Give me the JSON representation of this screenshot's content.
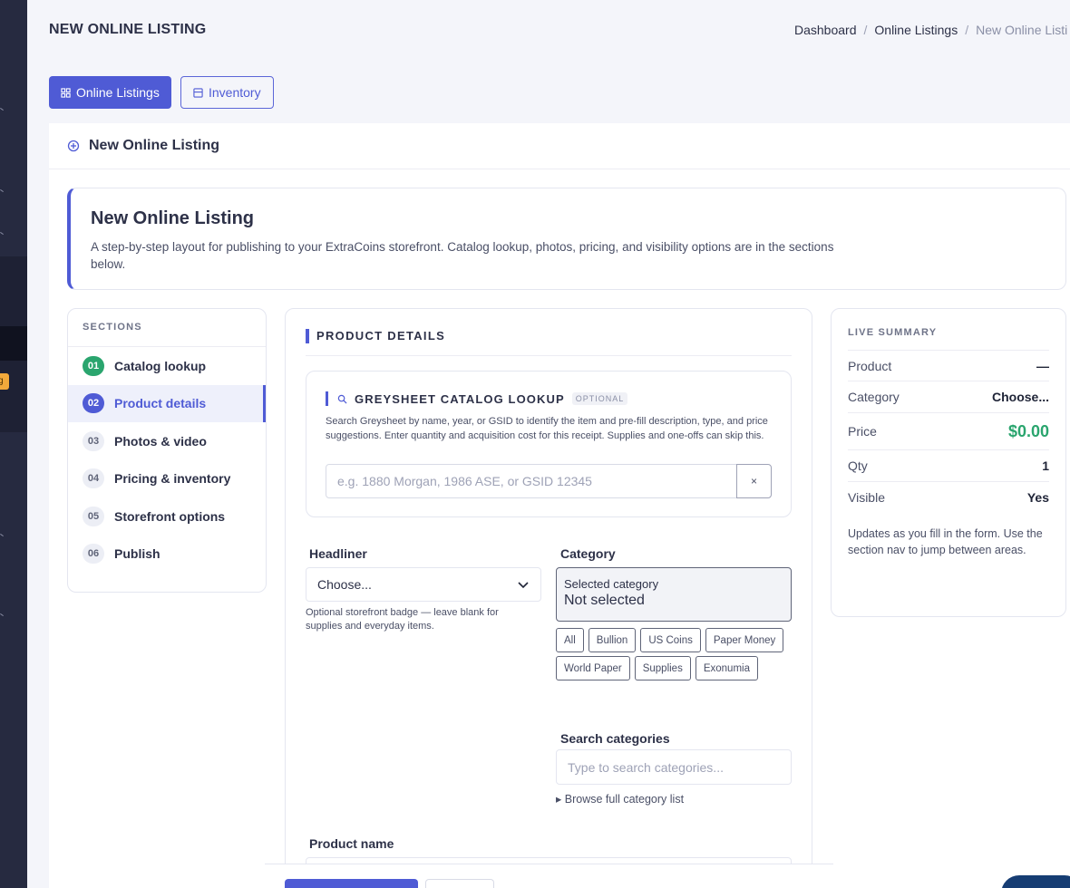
{
  "page": {
    "title": "NEW ONLINE LISTING"
  },
  "breadcrumb": {
    "items": [
      "Dashboard",
      "Online Listings"
    ],
    "current": "New Online Listi"
  },
  "tabs": {
    "online_listings": "Online Listings",
    "inventory": "Inventory"
  },
  "card": {
    "header": "New Online Listing"
  },
  "hero": {
    "title": "New Online Listing",
    "description": "A step-by-step layout for publishing to your ExtraCoins storefront. Catalog lookup, photos, pricing, and visibility options are in the sections below."
  },
  "sections": {
    "heading": "SECTIONS",
    "items": [
      {
        "num": "01",
        "label": "Catalog lookup",
        "state": "done"
      },
      {
        "num": "02",
        "label": "Product details",
        "state": "active"
      },
      {
        "num": "03",
        "label": "Photos & video",
        "state": "pending"
      },
      {
        "num": "04",
        "label": "Pricing & inventory",
        "state": "pending"
      },
      {
        "num": "05",
        "label": "Storefront options",
        "state": "pending"
      },
      {
        "num": "06",
        "label": "Publish",
        "state": "pending"
      }
    ]
  },
  "details": {
    "title": "PRODUCT DETAILS",
    "lookup": {
      "title": "GREYSHEET CATALOG LOOKUP",
      "tag": "OPTIONAL",
      "description": "Search Greysheet by name, year, or GSID to identify the item and pre-fill description, type, and price suggestions. Enter quantity and acquisition cost for this receipt. Supplies and one-offs can skip this.",
      "placeholder": "e.g. 1880 Morgan, 1986 ASE, or GSID 12345",
      "clear": "×"
    },
    "headliner": {
      "label": "Headliner",
      "value": "Choose...",
      "hint": "Optional storefront badge — leave blank for supplies and everyday items."
    },
    "category": {
      "label": "Category",
      "selected_label": "Selected category",
      "selected_value": "Not selected",
      "chips": [
        "All",
        "Bullion",
        "US Coins",
        "Paper Money",
        "World Paper",
        "Supplies",
        "Exonumia"
      ],
      "search_label": "Search categories",
      "search_placeholder": "Type to search categories...",
      "browse": "▸ Browse full category list"
    },
    "product_name": {
      "label": "Product name"
    }
  },
  "summary": {
    "heading": "LIVE SUMMARY",
    "rows": [
      {
        "label": "Product",
        "value": "—"
      },
      {
        "label": "Category",
        "value": "Choose..."
      },
      {
        "label": "Price",
        "value": "$0.00"
      },
      {
        "label": "Qty",
        "value": "1"
      },
      {
        "label": "Visible",
        "value": "Yes"
      }
    ],
    "note": "Updates as you fill in the form. Use the section nav to jump between areas."
  },
  "rail": {
    "badge": "g"
  },
  "colors": {
    "accent": "#4f5bd5",
    "success": "#2aa56e",
    "sidebar": "#262a40"
  },
  "icons": [
    "grid-icon",
    "inventory-icon",
    "plus-circle-icon",
    "search-icon",
    "chevron-down-icon"
  ]
}
